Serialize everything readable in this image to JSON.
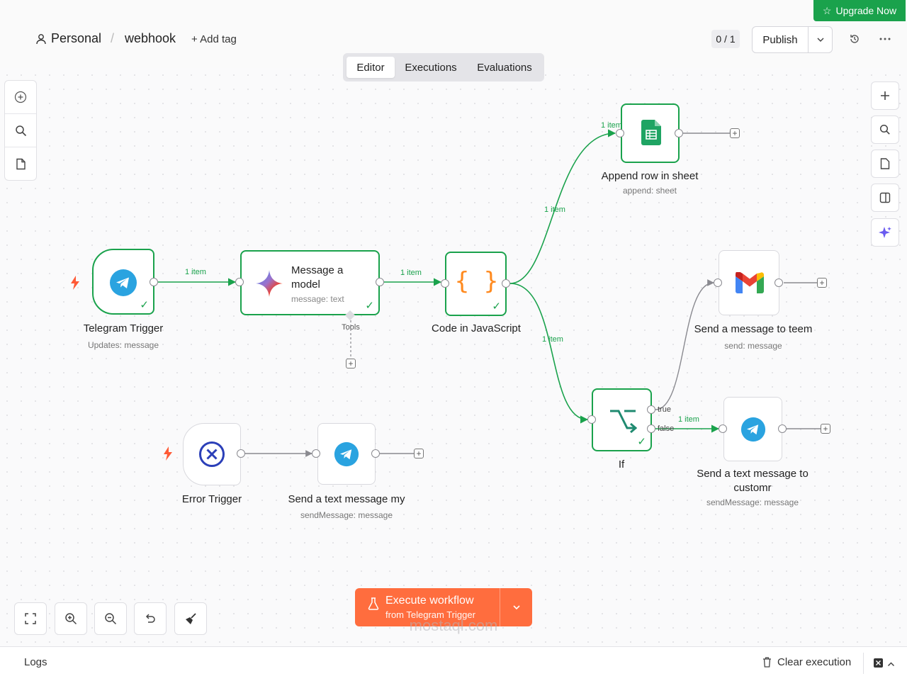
{
  "header": {
    "upgrade_label": "Upgrade Now",
    "project": "Personal",
    "separator": "/",
    "workflow_name": "webhook",
    "add_tag": "+ Add tag",
    "counter": "0 / 1",
    "publish_label": "Publish"
  },
  "tabs": [
    {
      "label": "Editor",
      "active": true
    },
    {
      "label": "Executions",
      "active": false
    },
    {
      "label": "Evaluations",
      "active": false
    }
  ],
  "nodes": {
    "telegram_trigger": {
      "title": "Telegram Trigger",
      "subtitle": "Updates: message"
    },
    "message_model": {
      "title_line1": "Message a",
      "title_line2": "model",
      "subtitle": "message: text",
      "tools_label": "Tools"
    },
    "code_js": {
      "title": "Code in JavaScript",
      "glyph": "{ }"
    },
    "append_row": {
      "title": "Append row in sheet",
      "subtitle": "append: sheet"
    },
    "gmail": {
      "title": "Send a message to teem",
      "subtitle": "send: message"
    },
    "if_node": {
      "title": "If",
      "true_label": "true",
      "false_label": "false"
    },
    "send_customer": {
      "title_line1": "Send a text message to",
      "title_line2": "customr",
      "subtitle": "sendMessage: message"
    },
    "error_trigger": {
      "title": "Error Trigger"
    },
    "send_my": {
      "title": "Send a text message my",
      "subtitle": "sendMessage: message"
    }
  },
  "edges": {
    "tg_to_model": "1 item",
    "model_to_code": "1 item",
    "code_to_sheet": "1 item",
    "code_to_if": "1 item",
    "sheet_in": "1 item",
    "if_to_customer": "1 item"
  },
  "execute": {
    "line1": "Execute workflow",
    "line2": "from Telegram Trigger"
  },
  "logs": {
    "label": "Logs",
    "clear_label": "Clear execution"
  },
  "watermark": "mostaql.com",
  "colors": {
    "accent_green": "#1aa24c",
    "execute_orange": "#ff6d3e",
    "trigger_bolt": "#ff5a36",
    "telegram_blue": "#2aa3e0"
  }
}
